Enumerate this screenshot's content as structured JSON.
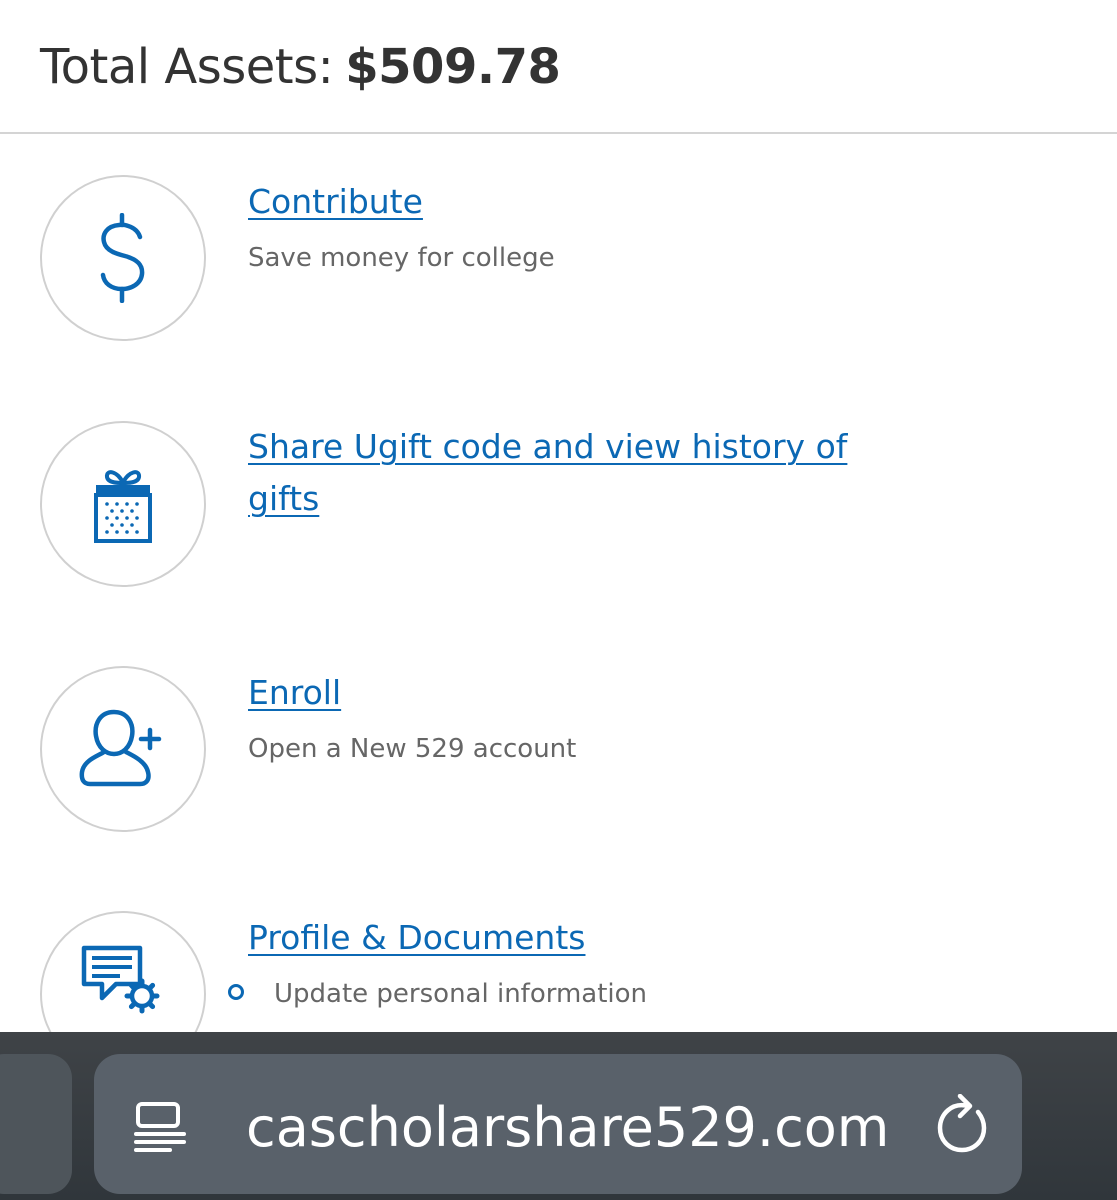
{
  "header": {
    "total_label": "Total Assets:",
    "total_value": "$509.78"
  },
  "actions": [
    {
      "id": "contribute",
      "title": "Contribute",
      "description": "Save money for college",
      "icon": "dollar-icon"
    },
    {
      "id": "ugift",
      "title": "Share Ugift code and view history of gifts",
      "description": "",
      "icon": "gift-icon"
    },
    {
      "id": "enroll",
      "title": "Enroll",
      "description": "Open a New 529 account",
      "icon": "add-user-icon"
    },
    {
      "id": "profile",
      "title": "Profile & Documents",
      "bullet": "Update personal information",
      "icon": "document-settings-icon"
    }
  ],
  "browser": {
    "url": "cascholarshare529.com",
    "reader_icon": "reader-mode-icon",
    "reload_icon": "reload-icon"
  },
  "colors": {
    "link": "#0b68b4",
    "text": "#333333",
    "muted": "#666666",
    "circle_border": "#d0d0d0"
  }
}
